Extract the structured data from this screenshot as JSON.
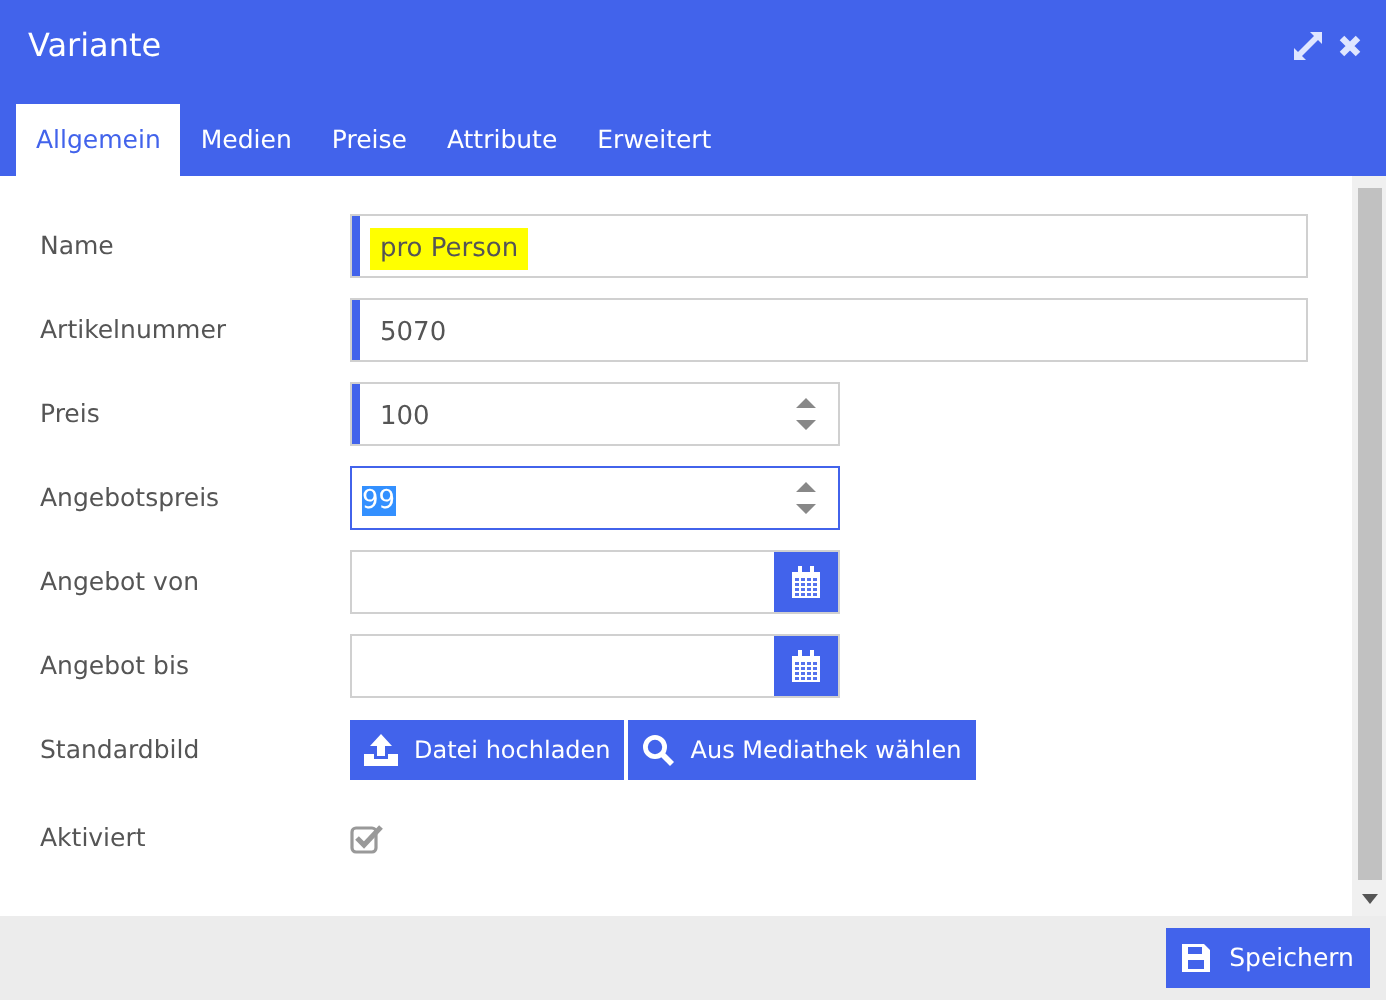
{
  "window": {
    "title": "Variante"
  },
  "tabs": [
    {
      "label": "Allgemein",
      "selected": true
    },
    {
      "label": "Medien",
      "selected": false
    },
    {
      "label": "Preise",
      "selected": false
    },
    {
      "label": "Attribute",
      "selected": false
    },
    {
      "label": "Erweitert",
      "selected": false
    }
  ],
  "fields": [
    {
      "kind": "text",
      "label": "Name",
      "value": "pro Person",
      "required": true,
      "highlighted": true,
      "focused": false
    },
    {
      "kind": "text",
      "label": "Artikelnummer",
      "value": "5070",
      "required": true,
      "highlighted": false,
      "focused": false
    },
    {
      "kind": "number",
      "label": "Preis",
      "value": "100",
      "required": true,
      "highlighted": false,
      "focused": false
    },
    {
      "kind": "number",
      "label": "Angebotspreis",
      "value": "99",
      "required": false,
      "highlighted": false,
      "focused": true
    },
    {
      "kind": "date",
      "label": "Angebot von"
    },
    {
      "kind": "date",
      "label": "Angebot bis"
    },
    {
      "kind": "media",
      "label": "Standardbild",
      "buttons": [
        {
          "kind": "upload",
          "label": "Datei hochladen"
        },
        {
          "kind": "library",
          "label": "Aus Mediathek wählen"
        }
      ]
    },
    {
      "kind": "checkbox",
      "label": "Aktiviert",
      "checked": true
    }
  ],
  "footer": {
    "save_button": "Speichern"
  }
}
